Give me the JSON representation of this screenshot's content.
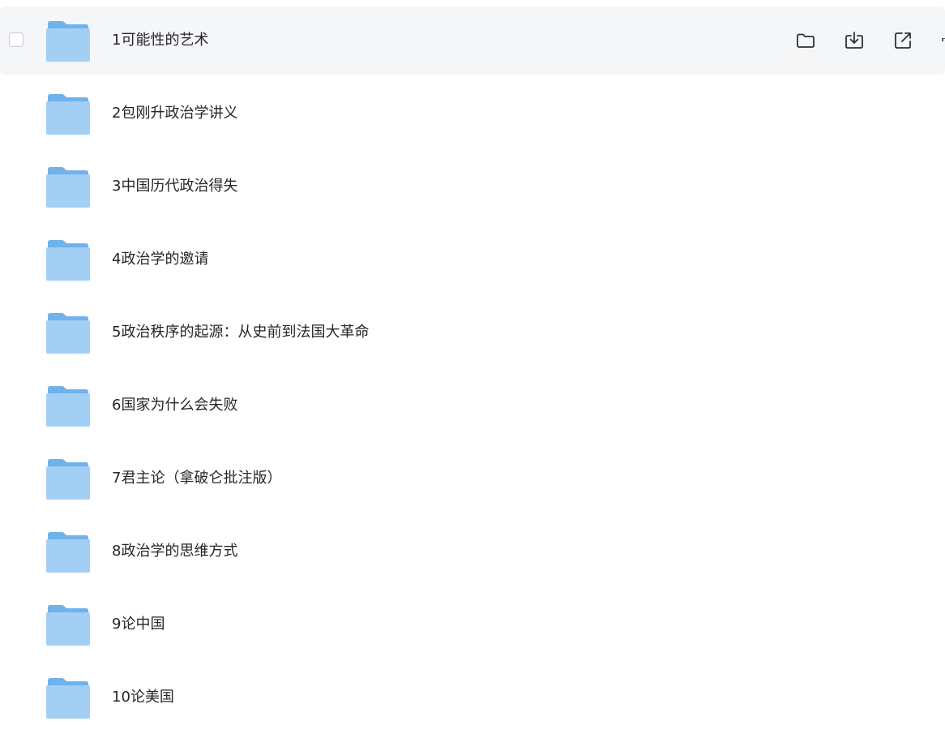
{
  "folders": [
    {
      "name": "1可能性的艺术"
    },
    {
      "name": "2包刚升政治学讲义"
    },
    {
      "name": "3中国历代政治得失"
    },
    {
      "name": "4政治学的邀请"
    },
    {
      "name": "5政治秩序的起源：从史前到法国大革命"
    },
    {
      "name": "6国家为什么会失败"
    },
    {
      "name": "7君主论（拿破仑批注版）"
    },
    {
      "name": "8政治学的思维方式"
    },
    {
      "name": "9论中国"
    },
    {
      "name": "10论美国"
    }
  ],
  "hovered_row_index": 0,
  "row_actions": [
    {
      "icon": "folder-icon"
    },
    {
      "icon": "download-icon"
    },
    {
      "icon": "share-icon"
    }
  ],
  "colors": {
    "folder_front": "#a3cff5",
    "folder_back": "#6fb2ec",
    "hover_bg": "#f5f6f8",
    "text": "#25262b",
    "icon_stroke": "#2c3040"
  }
}
